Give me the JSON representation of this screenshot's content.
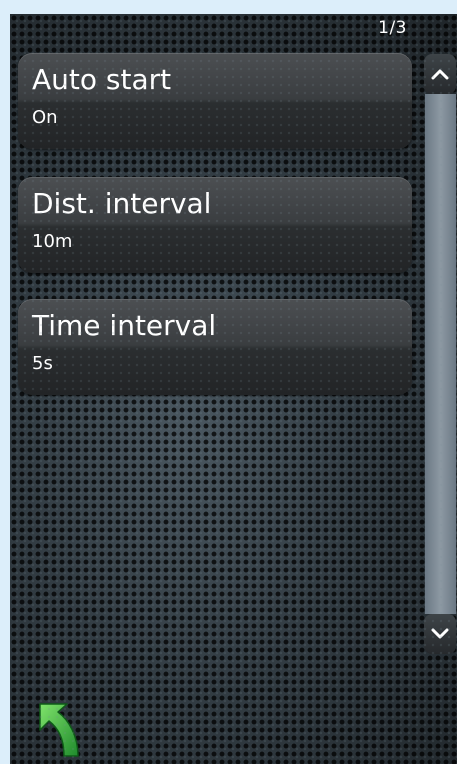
{
  "pager": {
    "page_indicator": "1/3"
  },
  "settings": [
    {
      "title": "Auto start",
      "value": "On"
    },
    {
      "title": "Dist. interval",
      "value": "10m"
    },
    {
      "title": "Time interval",
      "value": "5s"
    }
  ],
  "icons": {
    "scroll_up": "chevron-up-icon",
    "scroll_down": "chevron-down-icon",
    "back": "back-arrow-icon"
  },
  "colors": {
    "background": "#dceefa",
    "panel": "#2a3237",
    "item": "#3a3d40",
    "text": "#ffffff",
    "scroll_rail": "#8d99a3",
    "back_arrow": "#3fb54a"
  }
}
